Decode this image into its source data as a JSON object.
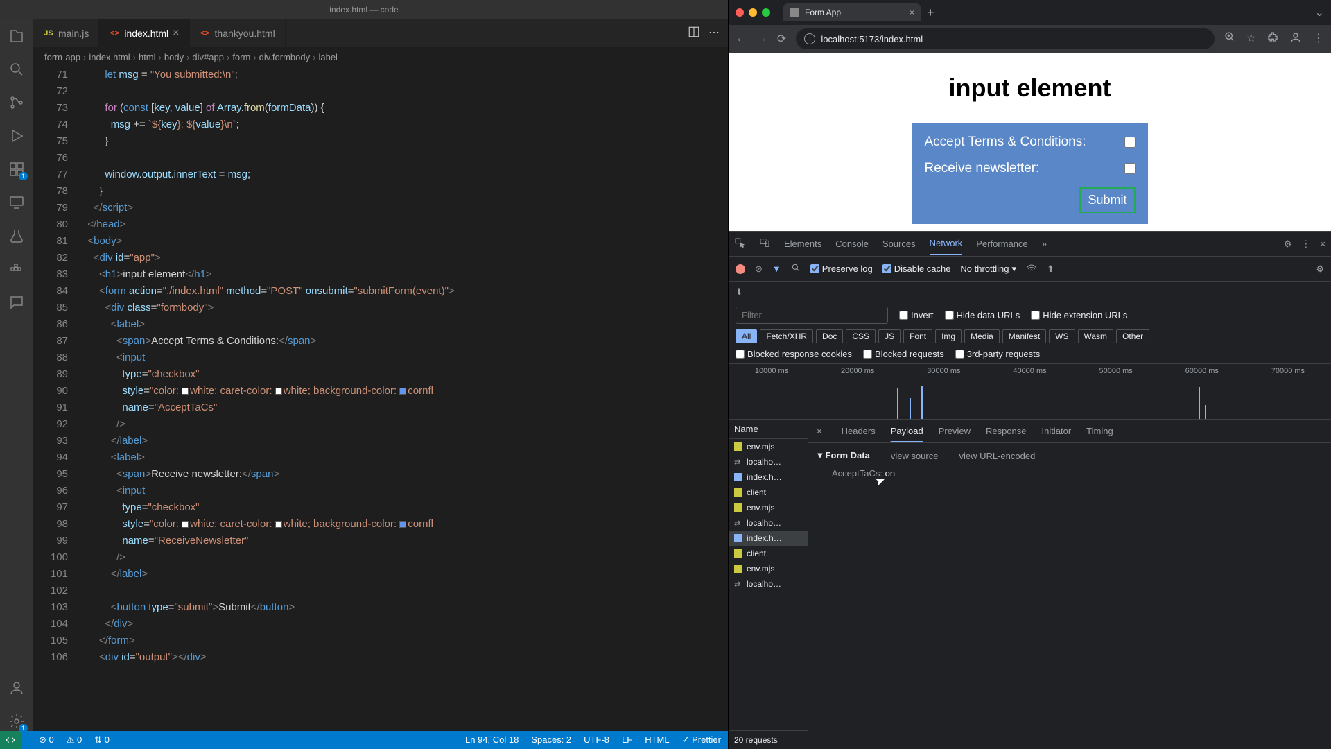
{
  "vscode": {
    "title": "index.html — code",
    "tabs": [
      {
        "icon": "js",
        "label": "main.js",
        "active": false,
        "close": false
      },
      {
        "icon": "html",
        "label": "index.html",
        "active": true,
        "close": true
      },
      {
        "icon": "html",
        "label": "thankyou.html",
        "active": false,
        "close": false
      }
    ],
    "breadcrumb": [
      "form-app",
      "index.html",
      "html",
      "body",
      "div#app",
      "form",
      "div.formbody",
      "label"
    ],
    "line_start": 71,
    "line_end": 106,
    "activity_badges": {
      "extensions": "1",
      "settings": "1"
    },
    "status": {
      "errors": "0",
      "warnings": "0",
      "ports": "0",
      "cursor": "Ln 94, Col 18",
      "spaces": "Spaces: 2",
      "encoding": "UTF-8",
      "eol": "LF",
      "lang": "HTML",
      "prettier": "Prettier"
    }
  },
  "browser": {
    "tab_title": "Form App",
    "url": "localhost:5173/index.html",
    "page": {
      "heading": "input element",
      "label1": "Accept Terms & Conditions:",
      "label2": "Receive newsletter:",
      "submit": "Submit"
    }
  },
  "devtools": {
    "tabs": [
      "Elements",
      "Console",
      "Sources",
      "Network",
      "Performance"
    ],
    "active_tab": "Network",
    "preserve_log": "Preserve log",
    "disable_cache": "Disable cache",
    "throttling": "No throttling",
    "filter_placeholder": "Filter",
    "invert": "Invert",
    "hide_data": "Hide data URLs",
    "hide_ext": "Hide extension URLs",
    "chips": [
      "All",
      "Fetch/XHR",
      "Doc",
      "CSS",
      "JS",
      "Font",
      "Img",
      "Media",
      "Manifest",
      "WS",
      "Wasm",
      "Other"
    ],
    "blocked_cookies": "Blocked response cookies",
    "blocked_req": "Blocked requests",
    "third_party": "3rd-party requests",
    "timeline_ticks": [
      "10000 ms",
      "20000 ms",
      "30000 ms",
      "40000 ms",
      "50000 ms",
      "60000 ms",
      "70000 ms"
    ],
    "name_header": "Name",
    "requests": [
      {
        "name": "env.mjs",
        "type": "js"
      },
      {
        "name": "localho…",
        "type": "ws"
      },
      {
        "name": "index.h…",
        "type": "doc"
      },
      {
        "name": "client",
        "type": "js"
      },
      {
        "name": "env.mjs",
        "type": "js"
      },
      {
        "name": "localho…",
        "type": "ws"
      },
      {
        "name": "index.h…",
        "type": "doc",
        "selected": true
      },
      {
        "name": "client",
        "type": "js"
      },
      {
        "name": "env.mjs",
        "type": "js"
      },
      {
        "name": "localho…",
        "type": "ws"
      }
    ],
    "request_count": "20 requests",
    "detail_tabs": [
      "Headers",
      "Payload",
      "Preview",
      "Response",
      "Initiator",
      "Timing"
    ],
    "detail_active": "Payload",
    "form_data_title": "Form Data",
    "view_source": "view source",
    "view_encoded": "view URL-encoded",
    "payload_key": "AcceptTaCs:",
    "payload_value": "on"
  }
}
